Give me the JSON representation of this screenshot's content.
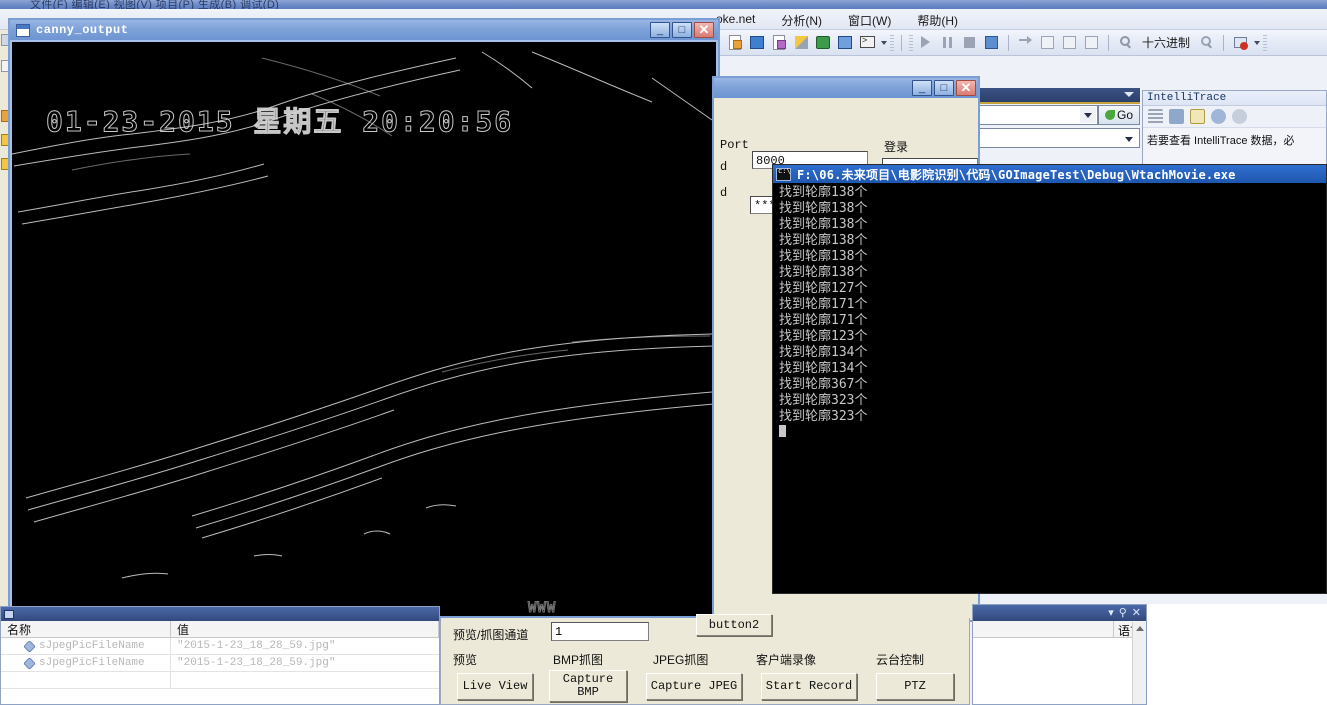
{
  "shell": {
    "title_text": "文件(F) 编辑(E) 视图(V)   项目(P) 生成(B) 调试(D)",
    "menu": [
      {
        "label": "oke.net"
      },
      {
        "label": "分析(N)"
      },
      {
        "label": "窗口(W)"
      },
      {
        "label": "帮助(H)"
      }
    ],
    "toolbar": {
      "hex_label": "十六进制",
      "icons": [
        "new-item-icon",
        "add-item-icon",
        "properties-icon",
        "tools-icon",
        "start-debug-icon",
        "attach-process-icon",
        "console-icon",
        "dropdown-caret-icon",
        "continue-icon",
        "break-all-icon",
        "stop-debugging-icon",
        "restart-icon",
        "show-next-statement-icon",
        "step-into-icon",
        "step-over-icon",
        "step-out-icon",
        "find-icon",
        "breakpoint-icon",
        "warning-icon"
      ]
    }
  },
  "intellitrace": {
    "title": "IntelliTrace",
    "message": "若要查看 IntelliTrace 数据，必",
    "tools": [
      "events-list-icon",
      "calls-view-icon",
      "options-icon",
      "history-icon",
      "broken-history-icon"
    ]
  },
  "navbar": {
    "go_label": "Go",
    "combo_value": "",
    "combo2_value": ""
  },
  "canny_window": {
    "title": "canny_output",
    "timestamp_overlay": "01-23-2015 星期五 20:20:56",
    "watermark": "WWW",
    "buttons": {
      "minimize": "_",
      "maximize": "□",
      "close": "✕"
    }
  },
  "login_dialog": {
    "port_label": "Port",
    "port_value": "8000",
    "login_label": "登录",
    "password_value": "***",
    "id_label": "d",
    "user_label": "d"
  },
  "console_window": {
    "title": "F:\\06.未来项目\\电影院识别\\代码\\GOImageTest\\Debug\\WtachMovie.exe",
    "lines": [
      "找到轮廓138个",
      "找到轮廓138个",
      "找到轮廓138个",
      "找到轮廓138个",
      "找到轮廓138个",
      "找到轮廓138个",
      "找到轮廓127个",
      "找到轮廓171个",
      "找到轮廓171个",
      "找到轮廓123个",
      "找到轮廓134个",
      "找到轮廓134个",
      "找到轮廓367个",
      "找到轮廓323个",
      "找到轮廓323个"
    ]
  },
  "watch_window": {
    "columns": [
      "名称",
      "值"
    ],
    "rows": [
      {
        "name": "sJpegPicFileName",
        "value": "\"2015-1-23_18_28_59.jpg\""
      },
      {
        "name": "sJpegPicFileName",
        "value": "\"2015-1-23_18_28_59.jpg\""
      },
      {
        "name": "",
        "value": ""
      }
    ]
  },
  "device_panel": {
    "channel_label": "预览/抓图通道",
    "channel_value": "1",
    "button2_label": "button2",
    "groups": [
      {
        "label": "预览",
        "button": "Live View"
      },
      {
        "label": "BMP抓图",
        "button": "Capture\nBMP"
      },
      {
        "label": "JPEG抓图",
        "button": "Capture JPEG"
      },
      {
        "label": "客户端录像",
        "button": "Start Record"
      },
      {
        "label": "云台控制",
        "button": "PTZ"
      }
    ]
  },
  "right_panel": {
    "column": "语言",
    "pin_icon": "pin-icon",
    "close_icon": "close-icon",
    "menu_icon": "chevron-down-icon"
  },
  "colors": {
    "title_blue": "#6e95d2",
    "console_blue": "#1f57ae",
    "vs_chrome": "#e2e8f4",
    "dialog_face": "#ece9d8"
  }
}
